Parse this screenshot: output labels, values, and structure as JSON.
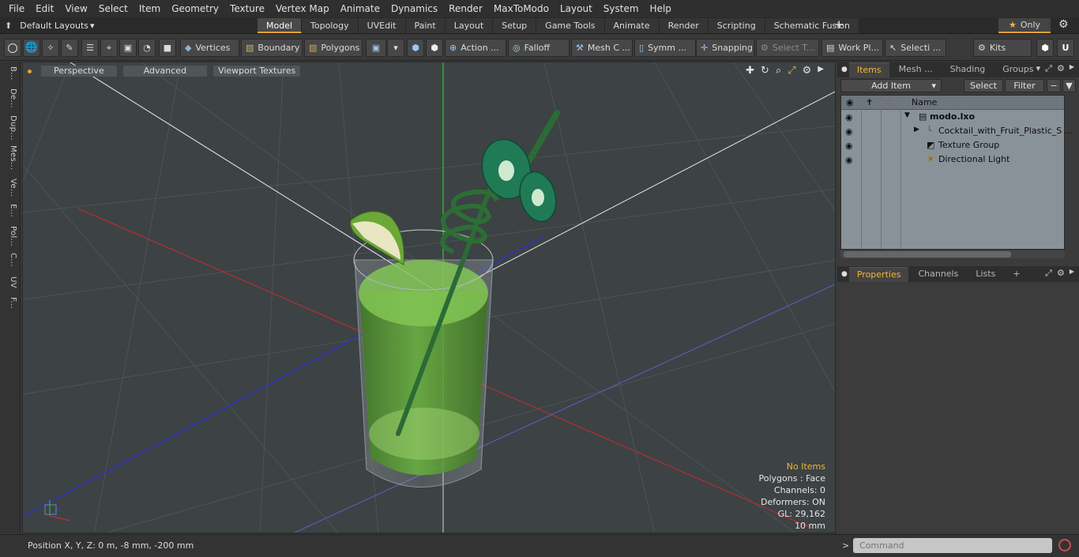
{
  "menu": [
    "File",
    "Edit",
    "View",
    "Select",
    "Item",
    "Geometry",
    "Texture",
    "Vertex Map",
    "Animate",
    "Dynamics",
    "Render",
    "MaxToModo",
    "Layout",
    "System",
    "Help"
  ],
  "layout": {
    "selector": "Default Layouts",
    "tabs": [
      "Model",
      "Topology",
      "UVEdit",
      "Paint",
      "Layout",
      "Setup",
      "Game Tools",
      "Animate",
      "Render",
      "Scripting",
      "Schematic Fusion"
    ],
    "active_tab": "Model",
    "only_label": "Only"
  },
  "toolbar": {
    "vertices": "Vertices",
    "boundary": "Boundary",
    "polygons": "Polygons",
    "action": "Action ...",
    "falloff": "Falloff",
    "mesh": "Mesh C ...",
    "symm": "Symm ...",
    "snapping": "Snapping",
    "select_t": "Select T...",
    "workplane": "Work Pl...",
    "selection": "Selecti ...",
    "kits": "Kits"
  },
  "left_strip": [
    "B...",
    "De...",
    "Dup...",
    "Mes...",
    "Ve...",
    "E...",
    "Pol...",
    "C...",
    "UV",
    "F..."
  ],
  "viewport": {
    "view": "Perspective",
    "shading": "Advanced",
    "textures": "Viewport Textures",
    "stats": {
      "no_items": "No Items",
      "polygons": "Polygons : Face",
      "channels": "Channels: 0",
      "deformers": "Deformers: ON",
      "gl": "GL: 29,162",
      "scale": "10 mm"
    }
  },
  "items_panel": {
    "tabs": [
      "Items",
      "Mesh ...",
      "Shading",
      "Groups"
    ],
    "active": "Items",
    "add_item": "Add Item",
    "select": "Select",
    "filter": "Filter",
    "column_name": "Name",
    "rows": [
      {
        "label": "modo.lxo"
      },
      {
        "label": "Cocktail_with_Fruit_Plastic_S ..."
      },
      {
        "label": "Texture Group"
      },
      {
        "label": "Directional Light"
      }
    ]
  },
  "props_panel": {
    "tabs": [
      "Properties",
      "Channels",
      "Lists"
    ],
    "active": "Properties"
  },
  "status": {
    "position": "Position X, Y, Z:   0 m, -8 mm, -200 mm",
    "command_placeholder": "Command"
  },
  "colors": {
    "accent": "#e8a23a",
    "viewport_bg": "#3d4245",
    "liquid": "#5fae3a",
    "kiwi": "#1f7a55"
  }
}
